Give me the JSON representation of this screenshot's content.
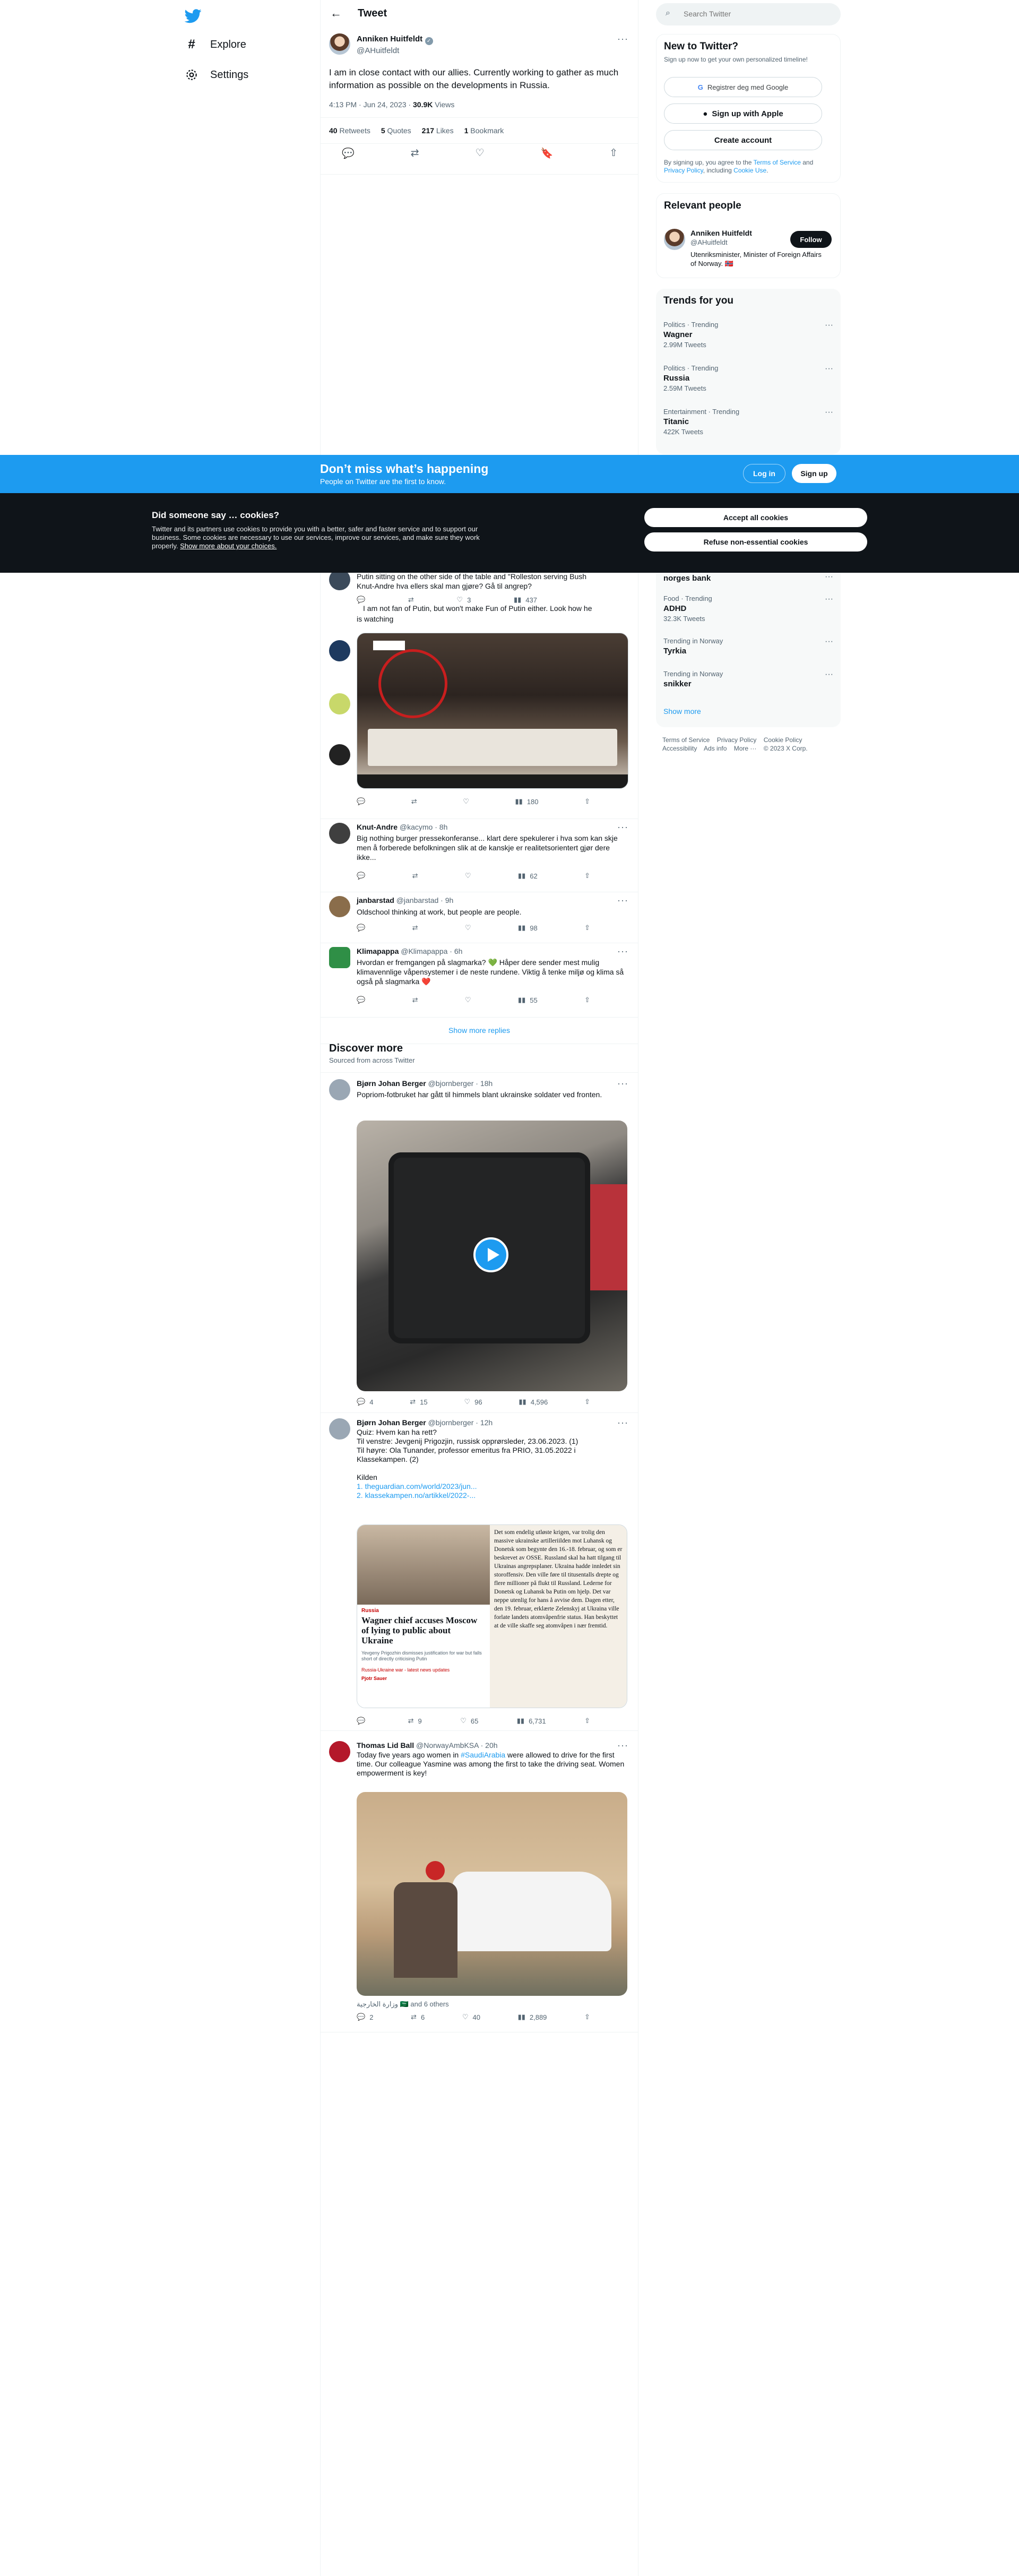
{
  "nav": {
    "items": [
      {
        "label": "Explore",
        "icon": "hash-icon"
      },
      {
        "label": "Settings",
        "icon": "gear-icon"
      }
    ]
  },
  "header": {
    "title": "Tweet"
  },
  "main_tweet": {
    "name": "Anniken Huitfeldt",
    "handle": "@AHuitfeldt",
    "text": "I am in close contact with our allies. Currently working to gather as much information as possible on the developments in Russia.",
    "time": "4:13 PM · Jun 24, 2023",
    "views_count": "30.9K",
    "views_label": "Views",
    "stats": [
      {
        "count": "40",
        "label": "Retweets"
      },
      {
        "count": "5",
        "label": "Quotes"
      },
      {
        "count": "217",
        "label": "Likes"
      },
      {
        "count": "1",
        "label": "Bookmark"
      }
    ]
  },
  "replies": {
    "partial_line": "Putin sitting on the other side of the table and \"Rolleston serving Bush",
    "partial_line2": "Knut-Andre hva ellers skal man gjøre? Gå til angrep?",
    "partial_stats": [
      "",
      "",
      "3",
      "437"
    ],
    "embedded_text": "I am not fan of Putin, but won't make Fun of Putin either. Look how he",
    "embedded_text2": "is watching",
    "image_stats": [
      "",
      "",
      "",
      "180"
    ],
    "items": [
      {
        "name": "Knut-Andre",
        "handle": "@kacymo · 8h",
        "text": "Big nothing burger pressekonferanse... klart dere spekulerer i hva som kan skje men å forberede befolkningen slik at de kanskje er realitetsorientert gjør dere ikke...",
        "views": "62"
      },
      {
        "name": "janbarstad",
        "handle": "@janbarstad · 9h",
        "text": "Oldschool thinking at work, but people are people.",
        "views": "98"
      },
      {
        "name": "Klimapappa",
        "handle": "@Klimapappa · 6h",
        "text": "Hvordan er fremgangen på slagmarka? 💚 Håper dere sender mest mulig klimavennlige våpensystemer i de neste rundene. Viktig å tenke miljø og klima så også på slagmarka ❤️",
        "views": "55"
      }
    ],
    "show_more": "Show more replies"
  },
  "discover": {
    "title": "Discover more",
    "subtitle": "Sourced from across Twitter",
    "tweets": [
      {
        "name": "Bjørn Johan Berger",
        "handle": "@bjornberger · 18h",
        "text": "Popriom-fotbruket har gått til himmels blant ukrainske soldater ved fronten.",
        "stats": [
          "4",
          "15",
          "96",
          "4,596"
        ]
      },
      {
        "name": "Bjørn Johan Berger",
        "handle": "@bjornberger · 12h",
        "lines": [
          "Quiz: Hvem kan ha rett?",
          "Til venstre: Jevgenij Prigozjin, russisk opprørsleder, 23.06.2023. (1)",
          "Til høyre: Ola Tunander, professor emeritus fra PRIO, 31.05.2022 i Klassekampen. (2)",
          "",
          "Kilden"
        ],
        "links": [
          "1. theguardian.com/world/2023/jun...",
          "2. klassekampen.no/artikkel/2022-..."
        ],
        "card_left": {
          "tag": "Russia",
          "headline": "Wagner chief accuses Moscow of lying to public about Ukraine",
          "sub": "Yevgeny Prigozhin dismisses justification for war but falls short of directly criticising Putin",
          "meta": "Russia-Ukraine war - latest news updates",
          "source": "Pjotr Sauer"
        },
        "card_right": "Det som endelig utløste krigen, var trolig den massive ukrainske artilleriilden mot Luhansk og Donetsk som begynte den 16.-18. februar, og som er beskrevet av OSSE. Russland skal ha hatt tilgang til Ukrainas angrepsplaner. Ukraina hadde innledet sin storoffensiv. Den ville føre til titusentalls drepte og flere millioner på flukt til Russland. Lederne for Donetsk og Luhansk ba Putin om hjelp. Det var neppe utenlig for hans å avvise dem. Dagen etter, den 19. februar, erklærte Zelenskyj at Ukraina ville forlate landets atomvåpenfrie status. Han beskyttet at de ville skaffe seg atomvåpen i nær fremtid.",
        "stats": [
          "",
          "9",
          "65",
          "6,731"
        ]
      },
      {
        "name": "Thomas Lid Ball",
        "handle": "@NorwayAmbKSA · 20h",
        "text_pre": "Today five years ago women in ",
        "hashtag": "#SaudiArabia",
        "text_post": " were allowed to drive for the first time. Our colleague Yasmine was among the first to take the driving seat. Women empowerment is key!",
        "tagged": "وزارة الخارجية 🇸🇦 and 6 others",
        "stats": [
          "2",
          "6",
          "40",
          "2,889"
        ]
      }
    ]
  },
  "search": {
    "placeholder": "Search Twitter"
  },
  "new_to": {
    "title": "New to Twitter?",
    "subtitle": "Sign up now to get your own personalized timeline!",
    "google": "Registrer deg med Google",
    "apple": "Sign up with Apple",
    "create": "Create account",
    "terms_pre": "By signing up, you agree to the ",
    "terms_link": "Terms of Service",
    "terms_mid": " and ",
    "privacy_link": "Privacy Policy",
    "terms_mid2": ", including ",
    "cookie_link": "Cookie Use",
    "terms_end": "."
  },
  "relevant": {
    "title": "Relevant people",
    "name": "Anniken Huitfeldt",
    "handle": "@AHuitfeldt",
    "bio": "Utenriksminister, Minister of Foreign Affairs of Norway. 🇳🇴",
    "follow": "Follow"
  },
  "trends": {
    "title": "Trends for you",
    "top": [
      {
        "cat": "Politics · Trending",
        "name": "Wagner",
        "count": "2.99M Tweets"
      },
      {
        "cat": "Politics · Trending",
        "name": "Russia",
        "count": "2.59M Tweets"
      },
      {
        "cat": "Entertainment · Trending",
        "name": "Titanic",
        "count": "422K Tweets"
      }
    ],
    "bottom": [
      {
        "cat": "",
        "name": "norges bank",
        "count": ""
      },
      {
        "cat": "Food · Trending",
        "name": "ADHD",
        "count": "32.3K Tweets"
      },
      {
        "cat": "Trending in Norway",
        "name": "Tyrkia",
        "count": ""
      },
      {
        "cat": "Trending in Norway",
        "name": "snikker",
        "count": ""
      }
    ],
    "show_more": "Show more"
  },
  "footer": {
    "links": [
      "Terms of Service",
      "Privacy Policy",
      "Cookie Policy",
      "Accessibility",
      "Ads info",
      "More ···",
      "© 2023 X Corp."
    ]
  },
  "banner": {
    "title": "Don’t miss what’s happening",
    "subtitle": "People on Twitter are the first to know.",
    "login": "Log in",
    "signup": "Sign up"
  },
  "cookies": {
    "title": "Did someone say … cookies?",
    "text": "Twitter and its partners use cookies to provide you with a better, safer and faster service and to support our business. Some cookies are necessary to use our services, improve our services, and make sure they work properly.",
    "link": "Show more about your choices.",
    "accept": "Accept all cookies",
    "refuse": "Refuse non-essential cookies"
  },
  "colors": {
    "accent": "#1d9bf0",
    "banner": "#1d9bf0",
    "cookie_bg": "#0f1419"
  }
}
